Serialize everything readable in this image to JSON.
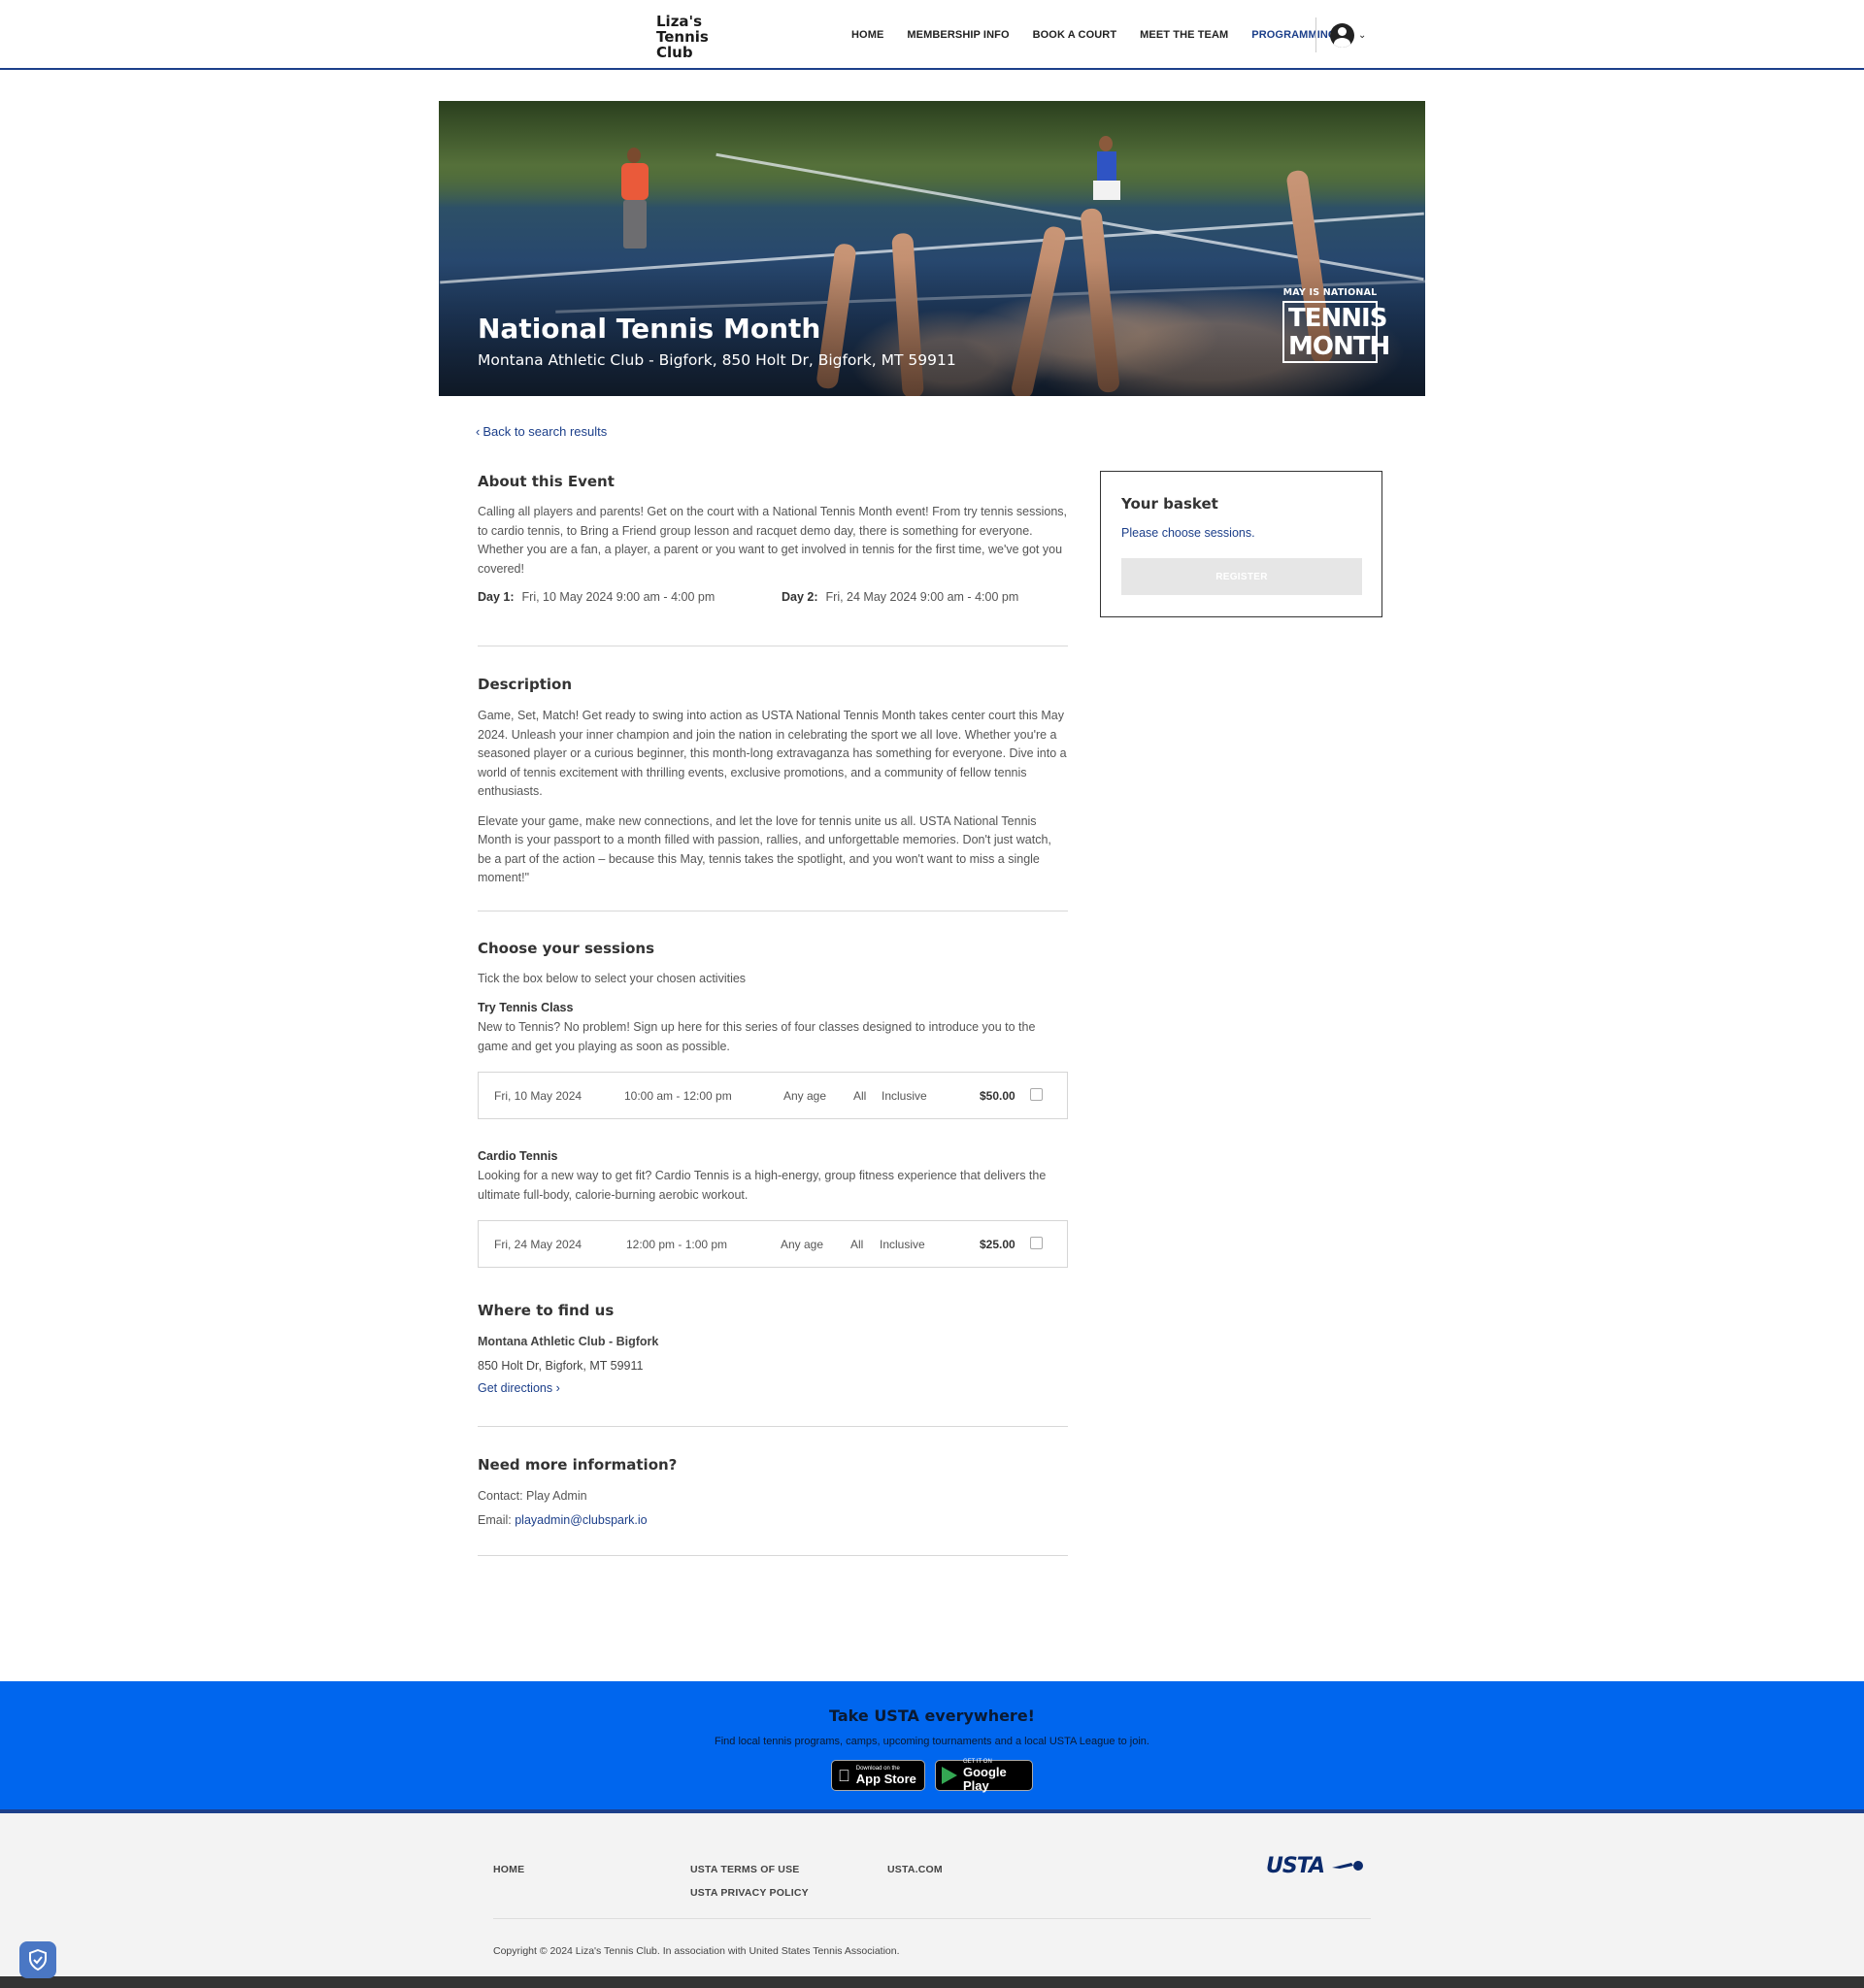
{
  "header": {
    "logo": "Liza's\nTennis\nClub",
    "nav": [
      "HOME",
      "MEMBERSHIP INFO",
      "BOOK A COURT",
      "MEET THE TEAM",
      "PROGRAMMING"
    ],
    "active_nav": "PROGRAMMING"
  },
  "hero": {
    "title": "National Tennis Month",
    "subtitle": "Montana Athletic Club - Bigfork, 850 Holt Dr, Bigfork, MT 59911",
    "badge_small": "MAY IS NATIONAL",
    "badge_big_1": "TENNIS",
    "badge_big_2": "MONTH"
  },
  "back_link": "Back to search results",
  "about": {
    "heading": "About this Event",
    "text": "Calling all players and parents! Get on the court with a National Tennis Month event! From try tennis sessions, to cardio tennis, to Bring a Friend group lesson and racquet demo day, there is something for everyone. Whether you are a fan, a player, a parent or you want to get involved in tennis for the first time, we've got you covered!",
    "day1_label": "Day 1:",
    "day1_value": "Fri, 10 May 2024 9:00 am - 4:00 pm",
    "day2_label": "Day 2:",
    "day2_value": "Fri, 24 May 2024 9:00 am - 4:00 pm"
  },
  "description": {
    "heading": "Description",
    "p1": "Game, Set, Match! Get ready to swing into action as USTA National Tennis Month takes center court this May 2024. Unleash your inner champion and join the nation in celebrating the sport we all love. Whether you're a seasoned player or a curious beginner, this month-long extravaganza has something for everyone. Dive into a world of tennis excitement with thrilling events, exclusive promotions, and a community of fellow tennis enthusiasts.",
    "p2": "Elevate your game, make new connections, and let the love for tennis unite us all. USTA National Tennis Month is your passport to a month filled with passion, rallies, and unforgettable memories. Don't just watch, be a part of the action – because this May, tennis takes the spotlight, and you won't want to miss a single moment!\""
  },
  "sessions": {
    "heading": "Choose your sessions",
    "hint": "Tick the box below to select your chosen activities",
    "items": [
      {
        "title": "Try Tennis Class",
        "text": "New to Tennis? No problem! Sign up here for this series of four classes designed to introduce you to the game and get you playing as soon as possible.",
        "date": "Fri, 10 May 2024",
        "time": "10:00 am - 12:00 pm",
        "age": "Any age",
        "level": "All",
        "gender": "Inclusive",
        "price": "$50.00"
      },
      {
        "title": "Cardio Tennis",
        "text": "Looking for a new way to get fit? Cardio Tennis is a high-energy, group fitness experience that delivers the ultimate full-body, calorie-burning aerobic workout.",
        "date": "Fri, 24 May 2024",
        "time": "12:00 pm - 1:00 pm",
        "age": "Any age",
        "level": "All",
        "gender": "Inclusive",
        "price": "$25.00"
      }
    ]
  },
  "location": {
    "heading": "Where to find us",
    "venue": "Montana Athletic Club - Bigfork",
    "address": "850 Holt Dr, Bigfork, MT 59911",
    "directions": "Get directions"
  },
  "contact": {
    "heading": "Need more information?",
    "contact": "Contact: Play Admin",
    "email_label": "Email:",
    "email": "playadmin@clubspark.io"
  },
  "basket": {
    "title": "Your basket",
    "message": "Please choose sessions.",
    "button": "REGISTER"
  },
  "promo": {
    "title": "Take USTA everywhere!",
    "subtitle": "Find local tennis programs, camps, upcoming tournaments and a local USTA League to join.",
    "appstore_small": "Download on the",
    "appstore_name": "App Store",
    "googleplay_small": "GET IT ON",
    "googleplay_name": "Google Play"
  },
  "footer": {
    "home": "HOME",
    "terms": "USTA TERMS OF USE",
    "privacy": "USTA PRIVACY POLICY",
    "usta_com": "USTA.COM",
    "logo": "USTA",
    "copyright": "Copyright © 2024 Liza's Tennis Club. In association with United States Tennis Association."
  },
  "colors": {
    "brand_navy": "#1c3f8a",
    "promo_blue": "#0066ee",
    "footer_bg": "#f3f3f3"
  }
}
